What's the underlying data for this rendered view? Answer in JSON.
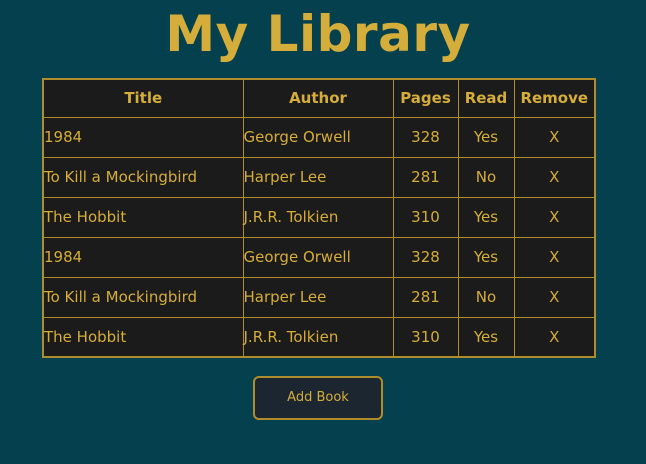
{
  "app": {
    "title": "My Library"
  },
  "table": {
    "headers": [
      "Title",
      "Author",
      "Pages",
      "Read",
      "Remove"
    ],
    "rows": [
      {
        "title": "1984",
        "author": "George Orwell",
        "pages": "328",
        "read": "Yes",
        "remove": "X"
      },
      {
        "title": "To Kill a Mockingbird",
        "author": "Harper Lee",
        "pages": "281",
        "read": "No",
        "remove": "X"
      },
      {
        "title": "The Hobbit",
        "author": "J.R.R. Tolkien",
        "pages": "310",
        "read": "Yes",
        "remove": "X"
      },
      {
        "title": "1984",
        "author": "George Orwell",
        "pages": "328",
        "read": "Yes",
        "remove": "X"
      },
      {
        "title": "To Kill a Mockingbird",
        "author": "Harper Lee",
        "pages": "281",
        "read": "No",
        "remove": "X"
      },
      {
        "title": "The Hobbit",
        "author": "J.R.R. Tolkien",
        "pages": "310",
        "read": "Yes",
        "remove": "X"
      }
    ]
  },
  "actions": {
    "add_book_label": "Add Book"
  },
  "colors": {
    "background": "#05404e",
    "accent": "#d5ad3a",
    "table_bg": "#1b1b1b",
    "border": "#b08d2c",
    "button_bg": "#1c2630"
  }
}
